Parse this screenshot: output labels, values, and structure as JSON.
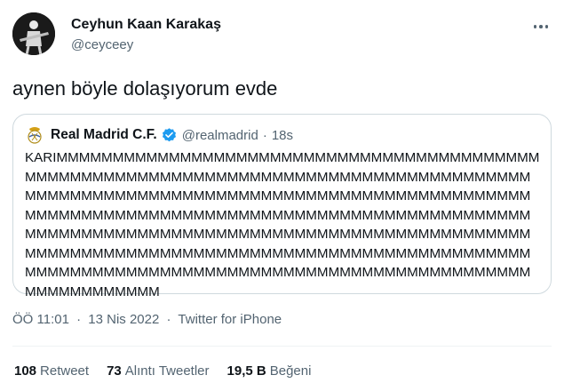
{
  "author": {
    "name": "Ceyhun Kaan Karakaş",
    "handle": "@ceyceey"
  },
  "tweet": {
    "text": "aynen böyle dolaşıyorum evde"
  },
  "quoted": {
    "name": "Real Madrid C.F.",
    "handle": "@realmadrid",
    "dot": "·",
    "time": "18s",
    "lines": [
      "KARIMMMMMMMMMMMMMMMMMMMMMMMMMMMMMMMMMMMMMMMMMMM",
      "MMMMMMMMMMMMMMMMMMMMMMMMMMMMMMMMMMMMMMMMMMMMM",
      "MMMMMMMMMMMMMMMMMMMMMMMMMMMMMMMMMMMMMMMMMMMMM",
      "MMMMMMMMMMMMMMMMMMMMMMMMMMMMMMMMMMMMMMMMMMMMM",
      "MMMMMMMMMMMMMMMMMMMMMMMMMMMMMMMMMMMMMMMMMMMMM",
      "MMMMMMMMMMMMMMMMMMMMMMMMMMMMMMMMMMMMMMMMMMMMM",
      "MMMMMMMMMMMMMMMMMMMMMMMMMMMMMMMMMMMMMMMMMMMMM",
      "MMMMMMMMMMMM"
    ]
  },
  "meta": {
    "time": "ÖÖ 11:01",
    "sep1": "·",
    "date": "13 Nis 2022",
    "sep2": "·",
    "source": "Twitter for iPhone"
  },
  "stats": {
    "retweets_count": "108",
    "retweets_label": "Retweet",
    "quotes_count": "73",
    "quotes_label": "Alıntı Tweetler",
    "likes_count": "19,5 B",
    "likes_label": "Beğeni"
  },
  "colors": {
    "text": "#0f1419",
    "secondary": "#536471",
    "border": "#cfd9de",
    "verified": "#1d9bf0"
  },
  "icons": {
    "more": "more-dots-icon",
    "verified": "verified-badge-icon",
    "crest": "real-madrid-crest-icon"
  }
}
